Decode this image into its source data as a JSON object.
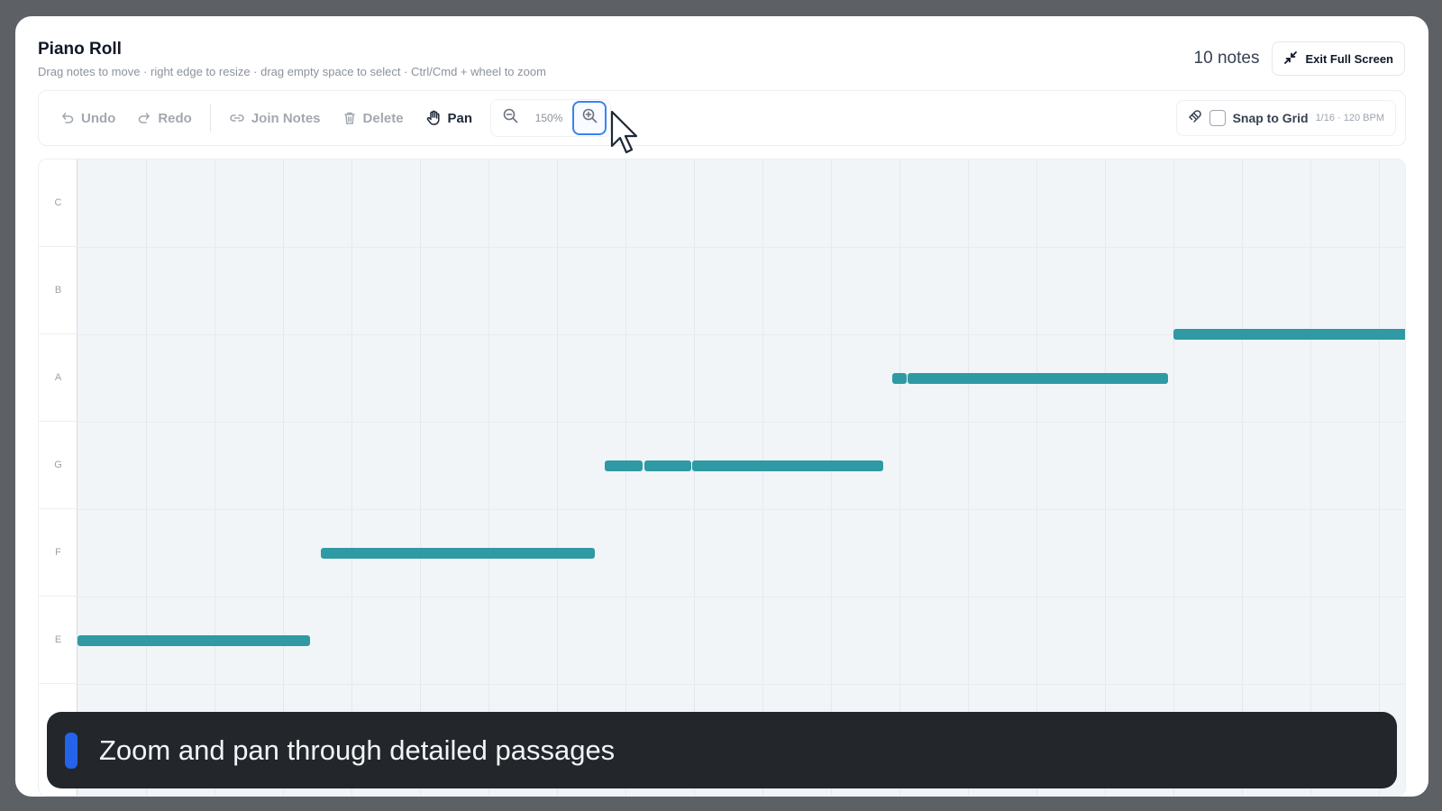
{
  "header": {
    "title": "Piano Roll",
    "subtitle": "Drag notes to move · right edge to resize · drag empty space to select · Ctrl/Cmd + wheel to zoom",
    "notes_count": "10 notes",
    "exit_label": "Exit Full Screen"
  },
  "toolbar": {
    "undo_label": "Undo",
    "redo_label": "Redo",
    "join_label": "Join Notes",
    "delete_label": "Delete",
    "pan_label": "Pan",
    "zoom_level": "150%",
    "snap_label": "Snap to Grid",
    "snap_checked": false,
    "snap_info": "1/16 · 120 BPM"
  },
  "keys": [
    "C",
    "B",
    "A",
    "G",
    "F",
    "E"
  ],
  "notes": [
    {
      "pitch": "E",
      "start": 0.0,
      "length": 3.4
    },
    {
      "pitch": "F",
      "start": 3.55,
      "length": 4.0
    },
    {
      "pitch": "G",
      "start": 7.7,
      "length": 0.55
    },
    {
      "pitch": "G",
      "start": 8.28,
      "length": 0.68
    },
    {
      "pitch": "G",
      "start": 8.98,
      "length": 2.78
    },
    {
      "pitch": "A",
      "start": 11.9,
      "length": 0.2
    },
    {
      "pitch": "A",
      "start": 12.12,
      "length": 3.8
    },
    {
      "pitch": "A#",
      "start": 16.0,
      "length": 3.8
    }
  ],
  "caption": "Zoom and pan through detailed passages",
  "colors": {
    "note": "#2f9aa3",
    "accent": "#3b82f6",
    "caption_bg": "#23272c"
  }
}
